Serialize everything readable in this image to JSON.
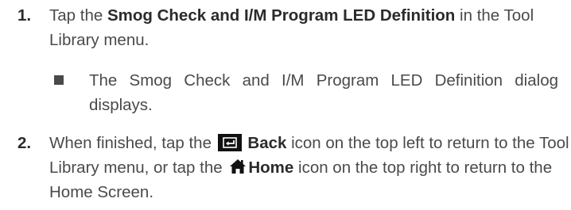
{
  "step1": {
    "number": "1.",
    "text_before": "Tap the ",
    "bold": "Smog Check and I/M Program LED Definition",
    "text_after": " in the Tool Library menu."
  },
  "bullet": {
    "text": "The Smog Check and I/M Program LED Definition dialog displays."
  },
  "step2": {
    "number": "2.",
    "text_1": "When finished, tap the ",
    "back_label": "Back",
    "text_2": " icon on the top left to return to the Tool Library menu, or tap the ",
    "home_label": "Home",
    "text_3": " icon on the top right to return to the Home Screen.",
    "back_icon": "back-arrow-icon",
    "home_icon": "home-icon"
  }
}
